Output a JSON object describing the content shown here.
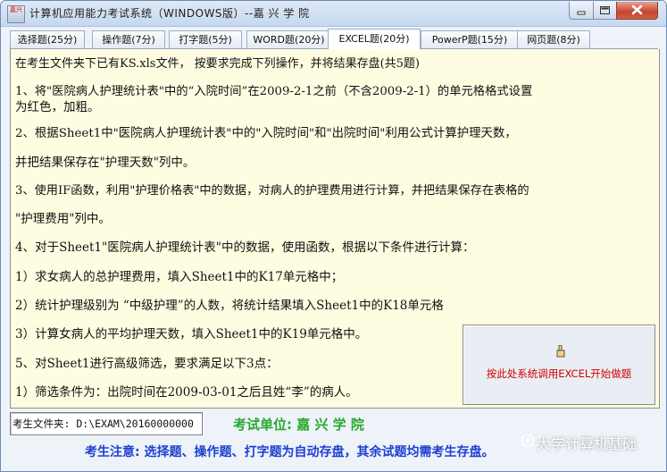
{
  "window": {
    "icon_text": "嘉兴",
    "title": "计算机应用能力考试系统（WINDOWS版）--嘉 兴 学 院"
  },
  "tabs": [
    {
      "label": "选择题(25分)"
    },
    {
      "label": "操作题(7分)"
    },
    {
      "label": "打字题(5分)"
    },
    {
      "label": "WORD题(20分)"
    },
    {
      "label": "EXCEL题(20分)"
    },
    {
      "label": "PowerP题(15分)"
    },
    {
      "label": "网页题(8分)"
    }
  ],
  "active_tab": "EXCEL题(20分)",
  "instructions": [
    "在考生文件夹下已有KS.xls文件， 按要求完成下列操作，并将结果存盘(共5题)",
    " 1、将\"医院病人护理统计表\"中的“入院时间”在2009-2-1之前（不含2009-2-1）的单元格格式设置",
    "为红色，加粗。",
    " 2、根据Sheet1中\"医院病人护理统计表\"中的\"入院时间\"和\"出院时间\"利用公式计算护理天数，",
    " 并把结果保存在\"护理天数\"列中。",
    " 3、使用IF函数，利用\"护理价格表\"中的数据，对病人的护理费用进行计算，并把结果保存在表格的",
    " \"护理费用\"列中。",
    "   4、对于Sheet1\"医院病人护理统计表\"中的数据，使用函数，根据以下条件进行计算：",
    "   1）求女病人的总护理费用，填入Sheet1中的K17单元格中；",
    "   2）统计护理级别为 “中级护理”的人数，将统计结果填入Sheet1中的K18单元格",
    "   3）计算女病人的平均护理天数，填入Sheet1中的K19单元格中。",
    " 5、对Sheet1进行高级筛选，要求满足以下3点：",
    "   1）筛选条件为：出院时间在2009-03-01之后且姓“李”的病人。"
  ],
  "launch_button": {
    "label": "按此处系统调用EXCEL开始做题",
    "icon": "pointing-hand-icon"
  },
  "folder": {
    "value": "考生文件夹: D:\\EXAM\\20160000000"
  },
  "exam_unit": "考试单位: 嘉 兴 学 院",
  "notice": "考生注意: 选择题、操作题、打字题为自动存盘，其余试题均需考生存盘。",
  "watermark": "大学计算机基础",
  "colors": {
    "content_bg": "#fffde1",
    "launch_text": "#d40000",
    "exam_unit": "#27a82c",
    "notice": "#1d3fd0",
    "close_button": "#c4452e"
  }
}
